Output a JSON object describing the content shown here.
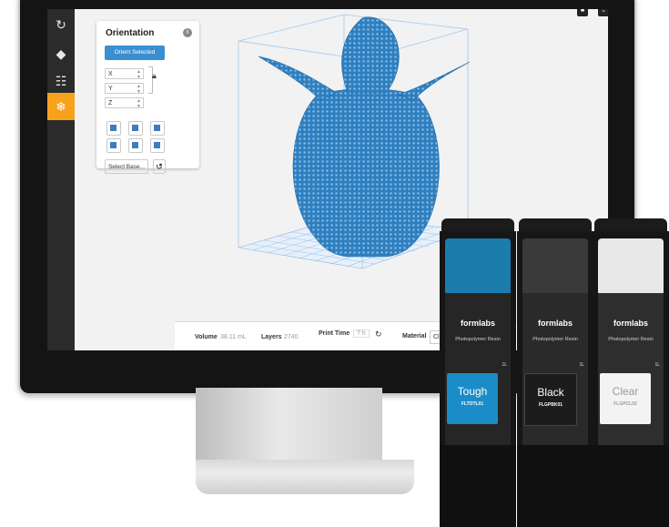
{
  "panel": {
    "title": "Orientation",
    "info_icon": "info-icon",
    "orient_button": "Orient Selected",
    "axes": [
      "X",
      "Y",
      "Z"
    ],
    "lock_icon": "lock-icon",
    "select_base": "Select Base...",
    "reset_icon": "reset-icon"
  },
  "toolbar": {
    "items": [
      "rotate-icon",
      "eraser-icon",
      "layout-icon",
      "supports-icon"
    ],
    "active": "supports-icon"
  },
  "statusbar": {
    "volume_label": "Volume",
    "volume_value": "38.11 mL",
    "layers_label": "Layers",
    "layers_value": "2740",
    "print_time_label": "Print Time",
    "print_time_value": "? h",
    "material_label": "Material",
    "material_value": "Clear 0.05 mm"
  },
  "cartridges": [
    {
      "brand": "formlabs",
      "subtitle": "Photopolymer Resin",
      "size": "1L",
      "name": "Tough",
      "code": "FLTOTL01",
      "label_color": "#1a8cc7",
      "accent": "#1a8cc7"
    },
    {
      "brand": "formlabs",
      "subtitle": "Photopolymer Resin",
      "size": "1L",
      "name": "Black",
      "code": "FLGPBK01",
      "label_color": "#1c1c1c",
      "accent": "#3a3a3a"
    },
    {
      "brand": "formlabs",
      "subtitle": "Photopolymer Resin",
      "size": "1L",
      "name": "Clear",
      "code": "FLGPCL02",
      "label_color": "#f3f3f3",
      "accent": "#e8e8e8"
    }
  ],
  "colors": {
    "accent": "#3a8fd1",
    "active_tool": "#f7a21b",
    "model": "#2e7fc0"
  }
}
